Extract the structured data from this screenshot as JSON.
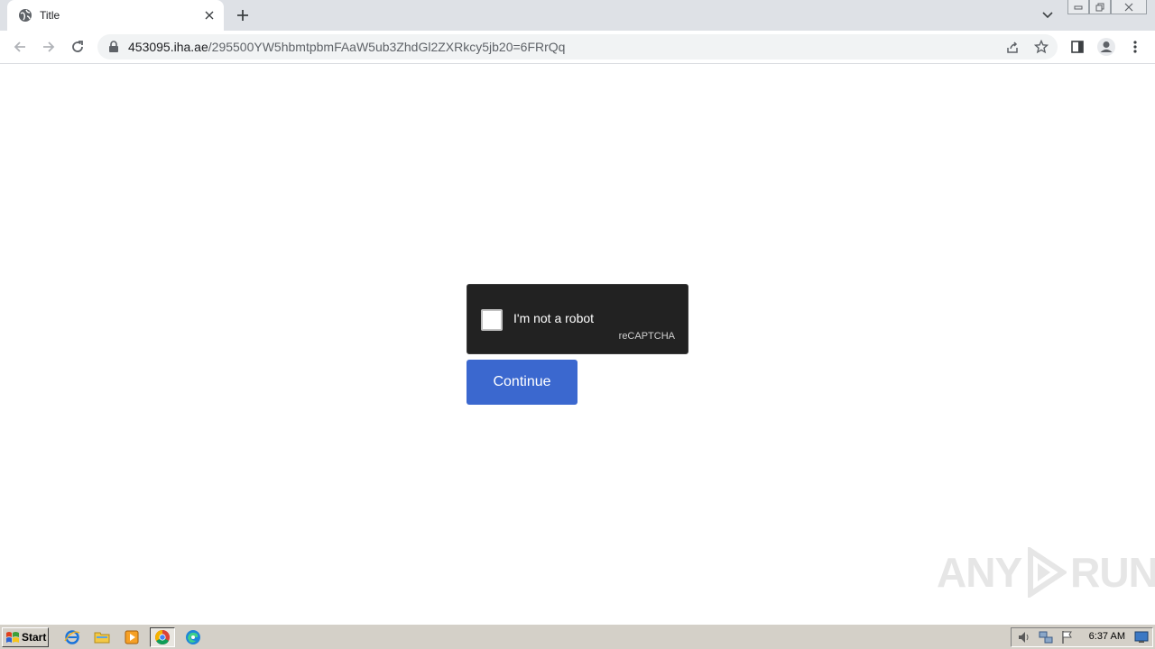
{
  "browser": {
    "tab": {
      "title": "Title",
      "favicon": "globe-icon"
    },
    "address": {
      "host": "453095.iha.ae",
      "path": "/295500YW5hbmtpbmFAaW5ub3ZhdGl2ZXRkcy5jb20=6FRrQq"
    }
  },
  "page": {
    "captcha": {
      "label": "I'm not a robot",
      "brand": "reCAPTCHA"
    },
    "continue_label": "Continue",
    "watermark": {
      "left": "ANY",
      "right": "RUN"
    }
  },
  "taskbar": {
    "start_label": "Start",
    "clock": "6:37 AM"
  },
  "colors": {
    "captcha_bg": "#222222",
    "continue_bg": "#3b68cf",
    "tabstrip_bg": "#dee1e6",
    "taskbar_bg": "#d4d0c8"
  }
}
